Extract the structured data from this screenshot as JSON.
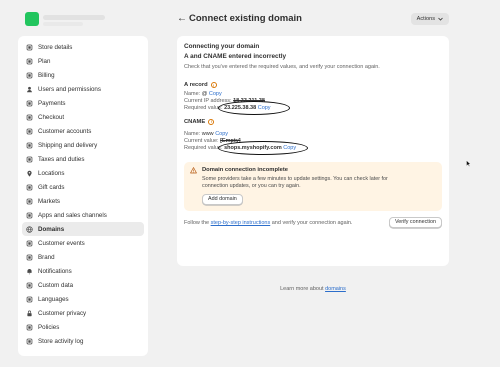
{
  "sidebar": {
    "items": [
      {
        "label": "Store details",
        "icon": "store-icon",
        "active": false
      },
      {
        "label": "Plan",
        "icon": "plan-icon",
        "active": false
      },
      {
        "label": "Billing",
        "icon": "billing-icon",
        "active": false
      },
      {
        "label": "Users and permissions",
        "icon": "users-icon",
        "active": false
      },
      {
        "label": "Payments",
        "icon": "payments-icon",
        "active": false
      },
      {
        "label": "Checkout",
        "icon": "checkout-icon",
        "active": false
      },
      {
        "label": "Customer accounts",
        "icon": "customer-accounts-icon",
        "active": false
      },
      {
        "label": "Shipping and delivery",
        "icon": "shipping-icon",
        "active": false
      },
      {
        "label": "Taxes and duties",
        "icon": "taxes-icon",
        "active": false
      },
      {
        "label": "Locations",
        "icon": "location-icon",
        "active": false
      },
      {
        "label": "Gift cards",
        "icon": "gift-card-icon",
        "active": false
      },
      {
        "label": "Markets",
        "icon": "markets-icon",
        "active": false
      },
      {
        "label": "Apps and sales channels",
        "icon": "apps-icon",
        "active": false
      },
      {
        "label": "Domains",
        "icon": "globe-icon",
        "active": true
      },
      {
        "label": "Customer events",
        "icon": "customer-events-icon",
        "active": false
      },
      {
        "label": "Brand",
        "icon": "brand-icon",
        "active": false
      },
      {
        "label": "Notifications",
        "icon": "bell-icon",
        "active": false
      },
      {
        "label": "Custom data",
        "icon": "custom-data-icon",
        "active": false
      },
      {
        "label": "Languages",
        "icon": "languages-icon",
        "active": false
      },
      {
        "label": "Customer privacy",
        "icon": "lock-icon",
        "active": false
      },
      {
        "label": "Policies",
        "icon": "policies-icon",
        "active": false
      },
      {
        "label": "Store activity log",
        "icon": "activity-log-icon",
        "active": false
      }
    ]
  },
  "header": {
    "title": "Connect existing domain",
    "actions_label": "Actions"
  },
  "card": {
    "title": "Connecting your domain",
    "subtitle": "A and CNAME entered incorrectly",
    "intro": "Check that you've entered the required values, and verify your connection again.",
    "a_record": {
      "heading": "A record",
      "name_label": "Name:",
      "name_value": "@",
      "copy": "Copy",
      "current_label": "Current IP address:",
      "current_value": "18.33.211.38",
      "required_label": "Required value:",
      "required_value": "23.225.38.38"
    },
    "cname": {
      "heading": "CNAME",
      "name_label": "Name:",
      "name_value": "www",
      "copy": "Copy",
      "current_label": "Current value:",
      "current_value": "[Empty]",
      "required_label": "Required value:",
      "required_value": "shops.myshopify.com"
    },
    "banner": {
      "title": "Domain connection incomplete",
      "text_line1": "Some providers take a few minutes to update settings. You can check later for",
      "text_line2": "connection updates, or you can try again.",
      "button": "Add domain"
    },
    "footer": {
      "text_before": "Follow the ",
      "link": "step-by-step instructions",
      "text_after": " and verify your connection again.",
      "verify_button": "Verify connection"
    }
  },
  "learn_more": {
    "text": "Learn more about ",
    "link": "domains"
  },
  "colors": {
    "brand_green": "#22c55e",
    "link_blue": "#2c6ecb",
    "warning_bg": "#fff4e4",
    "warning_accent": "#d97706"
  }
}
